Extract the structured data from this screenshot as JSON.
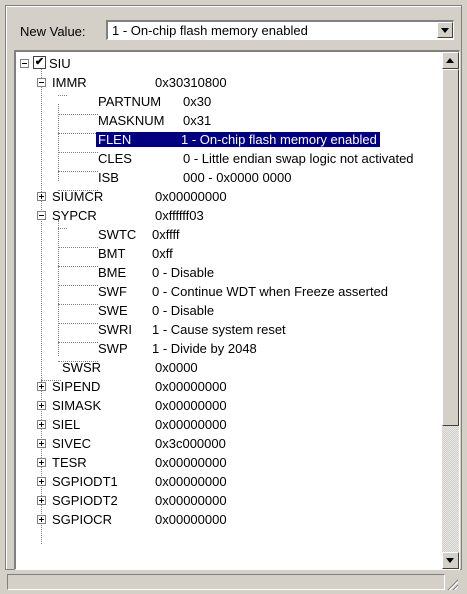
{
  "new_value": {
    "label": "New Value:",
    "selected": "1 - On-chip flash memory enabled"
  },
  "tree": {
    "root": {
      "name": "SIU",
      "checked": true,
      "check_mark": "✔"
    },
    "immr": {
      "name": "IMMR",
      "value": "0x30310800",
      "fields": [
        {
          "name": "PARTNUM",
          "value": "0x30"
        },
        {
          "name": "MASKNUM",
          "value": "0x31"
        },
        {
          "name": "FLEN",
          "value": "1 - On-chip flash memory enabled",
          "selected": true
        },
        {
          "name": "CLES",
          "value": "0 - Little endian swap logic not activated"
        },
        {
          "name": "ISB",
          "value": "000 - 0x0000 0000"
        }
      ]
    },
    "siumcr": {
      "name": "SIUMCR",
      "value": "0x00000000"
    },
    "sypcr": {
      "name": "SYPCR",
      "value": "0xffffff03",
      "fields": [
        {
          "name": "SWTC",
          "value": "0xffff"
        },
        {
          "name": "BMT",
          "value": "0xff"
        },
        {
          "name": "BME",
          "value": "0 - Disable"
        },
        {
          "name": "SWF",
          "value": "0 - Continue WDT when Freeze asserted"
        },
        {
          "name": "SWE",
          "value": "0 - Disable"
        },
        {
          "name": "SWRI",
          "value": "1 - Cause system reset"
        },
        {
          "name": "SWP",
          "value": "1 - Divide by 2048"
        }
      ]
    },
    "swsr": {
      "name": "SWSR",
      "value": "0x0000"
    },
    "registers": [
      {
        "name": "SIPEND",
        "value": "0x00000000"
      },
      {
        "name": "SIMASK",
        "value": "0x00000000"
      },
      {
        "name": "SIEL",
        "value": "0x00000000"
      },
      {
        "name": "SIVEC",
        "value": "0x3c000000"
      },
      {
        "name": "TESR",
        "value": "0x00000000"
      },
      {
        "name": "SGPIODT1",
        "value": "0x00000000"
      },
      {
        "name": "SGPIODT2",
        "value": "0x00000000"
      },
      {
        "name": "SGPIOCR",
        "value": "0x00000000"
      }
    ]
  },
  "colors": {
    "selection": "#000080",
    "window": "#d4d0c8"
  }
}
